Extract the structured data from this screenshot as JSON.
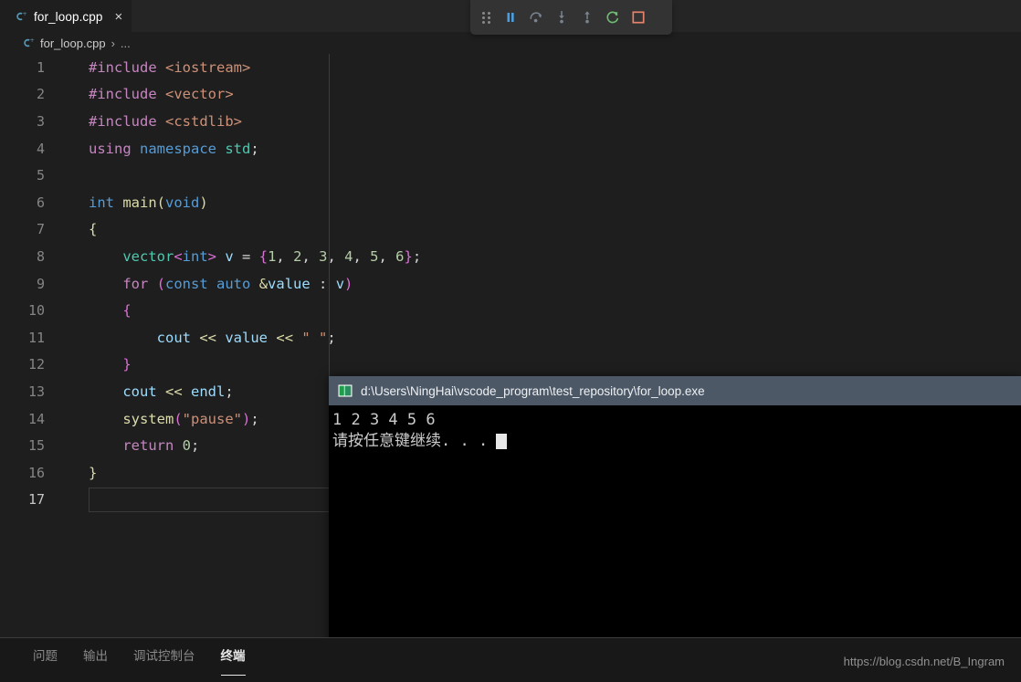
{
  "window": {
    "background": "#1e1e1e"
  },
  "tab": {
    "label": "for_loop.cpp",
    "close_glyph": "×",
    "icon": "cpp-file-icon"
  },
  "breadcrumb": {
    "file": "for_loop.cpp",
    "separator": "›",
    "overflow": "..."
  },
  "debug_toolbar": {
    "buttons": [
      {
        "name": "drag-handle",
        "title": "Drag",
        "color": "#8a8a8a"
      },
      {
        "name": "pause-button",
        "title": "Pause",
        "color": "#4a9ee0"
      },
      {
        "name": "step-over-button",
        "title": "Step Over",
        "color": "#7a8491"
      },
      {
        "name": "step-into-button",
        "title": "Step Into",
        "color": "#7a8491"
      },
      {
        "name": "step-out-button",
        "title": "Step Out",
        "color": "#7a8491"
      },
      {
        "name": "restart-button",
        "title": "Restart",
        "color": "#6fbf73"
      },
      {
        "name": "stop-button",
        "title": "Stop",
        "color": "#e8836b"
      }
    ]
  },
  "editor": {
    "current_line": 17,
    "lines": [
      {
        "n": "1",
        "tokens": [
          {
            "t": "#include ",
            "c": "t-pre"
          },
          {
            "t": "<iostream>",
            "c": "t-inc"
          }
        ]
      },
      {
        "n": "2",
        "tokens": [
          {
            "t": "#include ",
            "c": "t-pre"
          },
          {
            "t": "<vector>",
            "c": "t-inc"
          }
        ]
      },
      {
        "n": "3",
        "tokens": [
          {
            "t": "#include ",
            "c": "t-pre"
          },
          {
            "t": "<cstdlib>",
            "c": "t-inc"
          }
        ]
      },
      {
        "n": "4",
        "tokens": [
          {
            "t": "using ",
            "c": "t-ctl"
          },
          {
            "t": "namespace ",
            "c": "t-kw"
          },
          {
            "t": "std",
            "c": "t-type"
          },
          {
            "t": ";",
            "c": "t-plain"
          }
        ]
      },
      {
        "n": "5",
        "tokens": []
      },
      {
        "n": "6",
        "tokens": [
          {
            "t": "int ",
            "c": "t-kw"
          },
          {
            "t": "main",
            "c": "t-fn"
          },
          {
            "t": "(",
            "c": "t-brace1"
          },
          {
            "t": "void",
            "c": "t-kw"
          },
          {
            "t": ")",
            "c": "t-brace1"
          }
        ]
      },
      {
        "n": "7",
        "tokens": [
          {
            "t": "{",
            "c": "t-brace1"
          }
        ]
      },
      {
        "n": "8",
        "tokens": [
          {
            "t": "    ",
            "c": "t-plain"
          },
          {
            "t": "vector",
            "c": "t-type"
          },
          {
            "t": "<",
            "c": "t-brace2"
          },
          {
            "t": "int",
            "c": "t-kw"
          },
          {
            "t": ">",
            "c": "t-brace2"
          },
          {
            "t": " ",
            "c": "t-plain"
          },
          {
            "t": "v",
            "c": "t-var"
          },
          {
            "t": " ",
            "c": "t-plain"
          },
          {
            "t": "=",
            "c": "t-plain"
          },
          {
            "t": " ",
            "c": "t-plain"
          },
          {
            "t": "{",
            "c": "t-brace2"
          },
          {
            "t": "1",
            "c": "t-num"
          },
          {
            "t": ", ",
            "c": "t-plain"
          },
          {
            "t": "2",
            "c": "t-num"
          },
          {
            "t": ", ",
            "c": "t-plain"
          },
          {
            "t": "3",
            "c": "t-num"
          },
          {
            "t": ", ",
            "c": "t-plain"
          },
          {
            "t": "4",
            "c": "t-num"
          },
          {
            "t": ", ",
            "c": "t-plain"
          },
          {
            "t": "5",
            "c": "t-num"
          },
          {
            "t": ", ",
            "c": "t-plain"
          },
          {
            "t": "6",
            "c": "t-num"
          },
          {
            "t": "}",
            "c": "t-brace2"
          },
          {
            "t": ";",
            "c": "t-plain"
          }
        ]
      },
      {
        "n": "9",
        "tokens": [
          {
            "t": "    ",
            "c": "t-plain"
          },
          {
            "t": "for",
            "c": "t-ctl"
          },
          {
            "t": " ",
            "c": "t-plain"
          },
          {
            "t": "(",
            "c": "t-brace2"
          },
          {
            "t": "const ",
            "c": "t-kw"
          },
          {
            "t": "auto",
            "c": "t-kw"
          },
          {
            "t": " ",
            "c": "t-plain"
          },
          {
            "t": "&",
            "c": "t-opy"
          },
          {
            "t": "value",
            "c": "t-var"
          },
          {
            "t": " : ",
            "c": "t-plain"
          },
          {
            "t": "v",
            "c": "t-var"
          },
          {
            "t": ")",
            "c": "t-brace2"
          }
        ]
      },
      {
        "n": "10",
        "tokens": [
          {
            "t": "    ",
            "c": "t-plain"
          },
          {
            "t": "{",
            "c": "t-brace2"
          }
        ]
      },
      {
        "n": "11",
        "tokens": [
          {
            "t": "        ",
            "c": "t-plain"
          },
          {
            "t": "cout",
            "c": "t-var"
          },
          {
            "t": " ",
            "c": "t-plain"
          },
          {
            "t": "<<",
            "c": "t-opy"
          },
          {
            "t": " ",
            "c": "t-plain"
          },
          {
            "t": "value",
            "c": "t-var"
          },
          {
            "t": " ",
            "c": "t-plain"
          },
          {
            "t": "<<",
            "c": "t-opy"
          },
          {
            "t": " ",
            "c": "t-plain"
          },
          {
            "t": "\" \"",
            "c": "t-str"
          },
          {
            "t": ";",
            "c": "t-plain"
          }
        ]
      },
      {
        "n": "12",
        "tokens": [
          {
            "t": "    ",
            "c": "t-plain"
          },
          {
            "t": "}",
            "c": "t-brace2"
          }
        ]
      },
      {
        "n": "13",
        "tokens": [
          {
            "t": "    ",
            "c": "t-plain"
          },
          {
            "t": "cout",
            "c": "t-var"
          },
          {
            "t": " ",
            "c": "t-plain"
          },
          {
            "t": "<<",
            "c": "t-opy"
          },
          {
            "t": " ",
            "c": "t-plain"
          },
          {
            "t": "endl",
            "c": "t-var"
          },
          {
            "t": ";",
            "c": "t-plain"
          }
        ]
      },
      {
        "n": "14",
        "tokens": [
          {
            "t": "    ",
            "c": "t-plain"
          },
          {
            "t": "system",
            "c": "t-fn"
          },
          {
            "t": "(",
            "c": "t-brace2"
          },
          {
            "t": "\"pause\"",
            "c": "t-str"
          },
          {
            "t": ")",
            "c": "t-brace2"
          },
          {
            "t": ";",
            "c": "t-plain"
          }
        ]
      },
      {
        "n": "15",
        "tokens": [
          {
            "t": "    ",
            "c": "t-plain"
          },
          {
            "t": "return",
            "c": "t-ctl"
          },
          {
            "t": " ",
            "c": "t-plain"
          },
          {
            "t": "0",
            "c": "t-num"
          },
          {
            "t": ";",
            "c": "t-plain"
          }
        ]
      },
      {
        "n": "16",
        "tokens": [
          {
            "t": "}",
            "c": "t-brace1"
          }
        ]
      },
      {
        "n": "17",
        "tokens": []
      }
    ]
  },
  "console": {
    "title": "d:\\Users\\NingHai\\vscode_program\\test_repository\\for_loop.exe",
    "icon": "console-window-icon",
    "output_lines": [
      "1 2 3 4 5 6",
      "请按任意键继续. . ."
    ],
    "cursor_visible": true
  },
  "panel": {
    "tabs": [
      {
        "label": "问题",
        "active": false
      },
      {
        "label": "输出",
        "active": false
      },
      {
        "label": "调试控制台",
        "active": false
      },
      {
        "label": "终端",
        "active": true
      }
    ]
  },
  "watermark": {
    "text": "https://blog.csdn.net/B_Ingram"
  },
  "colors": {
    "editor_bg": "#1e1e1e",
    "tabbar_bg": "#252526",
    "panel_bg": "#181818",
    "toolbar_bg": "#333333",
    "console_title_bg": "#4c5866",
    "console_bg": "#000000",
    "accent_blue": "#4a9ee0",
    "accent_green": "#6fbf73",
    "accent_red": "#e8836b"
  }
}
